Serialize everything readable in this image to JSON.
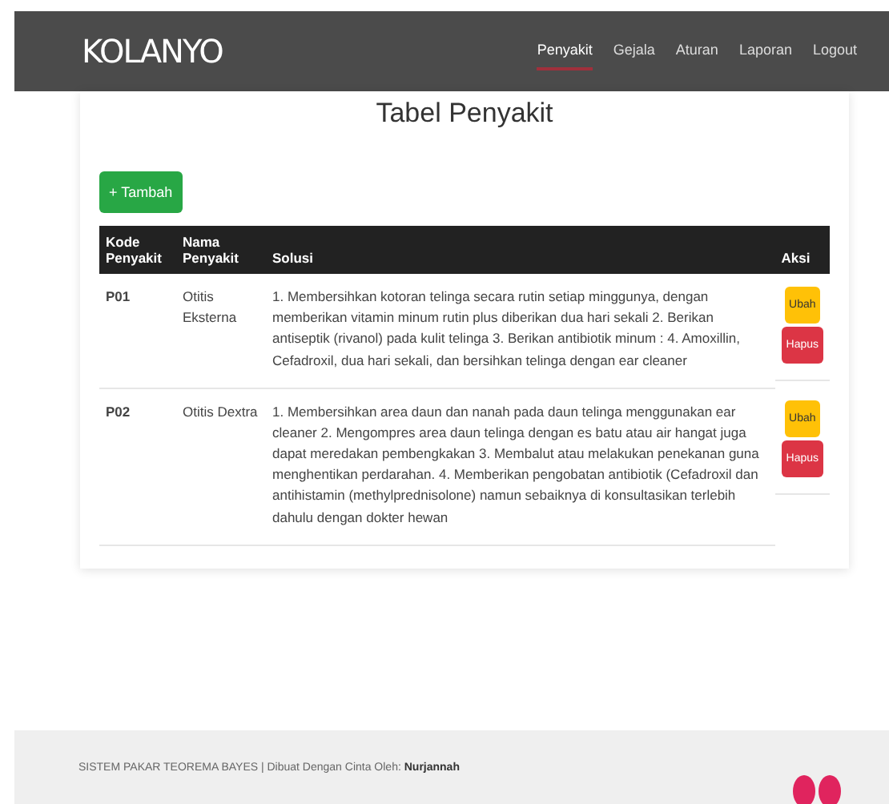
{
  "navbar": {
    "brand": "KOLANYO",
    "links": [
      {
        "label": "Penyakit",
        "selected": true
      },
      {
        "label": "Gejala",
        "selected": false
      },
      {
        "label": "Aturan",
        "selected": false
      },
      {
        "label": "Laporan",
        "selected": false
      },
      {
        "label": "Logout",
        "selected": false
      }
    ]
  },
  "title": "Tabel Penyakit",
  "add_button": "+ Tambah",
  "table": {
    "columns": [
      "Kode Penyakit",
      "Nama Penyakit",
      "Solusi",
      "Aksi"
    ],
    "rows": [
      {
        "code": "P01",
        "name": "Otitis Eksterna",
        "solution": "1. Membersihkan kotoran telinga secara rutin setiap minggunya, dengan memberikan vitamin minum rutin plus diberikan dua hari sekali 2. Berikan antiseptik (rivanol) pada kulit telinga 3. Berikan antibiotik minum : 4. Amoxillin, Cefadroxil, dua hari sekali, dan bersihkan telinga dengan ear cleaner",
        "edit": "Ubah",
        "delete": "Hapus"
      },
      {
        "code": "P02",
        "name": "Otitis Dextra",
        "solution": "1. Membersihkan area daun dan nanah pada daun telinga menggunakan ear cleaner 2. Mengompres area daun telinga dengan es batu atau air hangat juga dapat meredakan pembengkakan 3. Membalut atau melakukan penekanan guna menghentikan perdarahan. 4. Memberikan pengobatan antibiotik (Cefadroxil dan antihistamin (methylprednisolone) namun sebaiknya di konsultasikan terlebih dahulu dengan dokter hewan",
        "edit": "Ubah",
        "delete": "Hapus"
      }
    ]
  },
  "footer": {
    "text": "SISTEM PAKAR TEOREMA BAYES | Dibuat Dengan Cinta Oleh: ",
    "author": "Nurjannah"
  }
}
